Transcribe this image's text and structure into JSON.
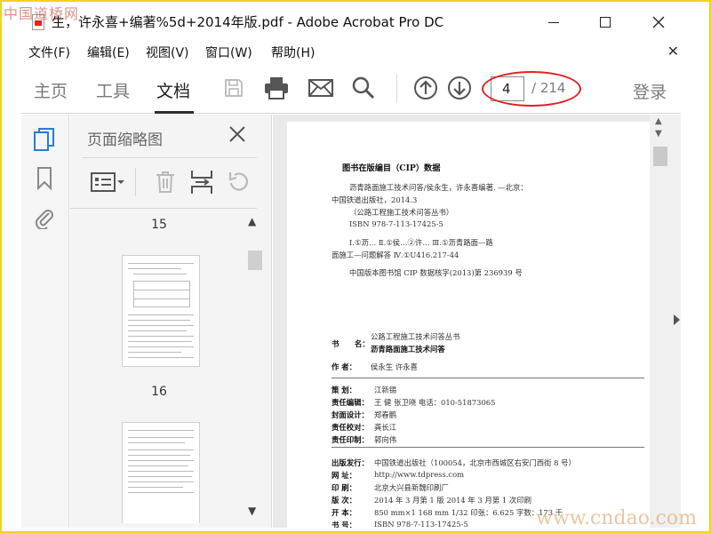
{
  "watermark": {
    "top": "中国道桥网",
    "bottom": "www.cndao.com"
  },
  "window": {
    "title": "生，许永喜+编著%5d+2014年版.pdf - Adobe Acrobat Pro DC",
    "minimize": "minimize",
    "maximize": "maximize",
    "close": "close"
  },
  "menu": {
    "items": [
      "文件(F)",
      "编辑(E)",
      "视图(V)",
      "窗口(W)",
      "帮助(H)"
    ],
    "close_glyph": "✕"
  },
  "toolbar": {
    "tabs": [
      "主页",
      "工具",
      "文档"
    ],
    "active_tab": "文档",
    "current_page": "4",
    "total_pages": "/ 214",
    "signin": "登录",
    "icons": [
      "save-icon",
      "print-icon",
      "mail-icon",
      "search-icon",
      "arrow-up-icon",
      "arrow-down-icon"
    ],
    "highlight_color": "#e02020"
  },
  "rail": {
    "icons": [
      "pages-icon",
      "bookmark-icon",
      "attachment-icon"
    ],
    "active_color": "#2b7bd6"
  },
  "thumbnails": {
    "title": "页面缩略图",
    "close": "✕",
    "tools": [
      "page-options-icon",
      "trash-icon",
      "insert-pages-icon",
      "undo-icon"
    ],
    "labels": [
      "15",
      "16"
    ]
  },
  "document": {
    "cip_title": "图书在版编目（CIP）数据",
    "lines": [
      "沥青路面施工技术问答/侯永生，许永喜编著. —北京：",
      "中国铁道出版社，2014.3",
      "（公路工程施工技术问答丛书）",
      "ISBN 978-7-113-17425-5",
      "Ⅰ.①沥…  Ⅱ.①侯…②许…  Ⅲ.①沥青路面—路",
      "面施工—问题解答  Ⅳ.①U416.217-44",
      "中国版本图书馆 CIP 数据核字(2013)第 236939 号"
    ],
    "book": {
      "shu_label": "书",
      "ming_label": "名：",
      "series": "公路工程施工技术问答丛书",
      "title": "沥青路面施工技术问答",
      "author_label": "作    者：",
      "author": "侯永生   许永喜"
    },
    "credits": [
      {
        "label": "策      划：",
        "value": "江新锡"
      },
      {
        "label": "责任编辑：",
        "value": "王   健    张卫晓          电话：010-51873065"
      },
      {
        "label": "封面设计：",
        "value": "郑春鹏"
      },
      {
        "label": "责任校对：",
        "value": "龚长江"
      },
      {
        "label": "责任印制：",
        "value": "郭向伟"
      }
    ],
    "publish": [
      {
        "label": "出版发行：",
        "value": "中国铁道出版社（100054，北京市西城区右安门西街 8 号）"
      },
      {
        "label": "网      址：",
        "value": "http://www.tdpress.com"
      },
      {
        "label": "印      刷：",
        "value": "北京大兴县新魏印刷厂"
      },
      {
        "label": "版      次：",
        "value": "2014 年 3 月第 1 版    2014 年 3 月第 1 次印刷"
      },
      {
        "label": "开      本：",
        "value": "850 mm×1 168 mm   1/32    印张：6.625    字数：173 千"
      },
      {
        "label": "书      号：",
        "value": "ISBN 978-7-113-17425-5"
      }
    ]
  }
}
